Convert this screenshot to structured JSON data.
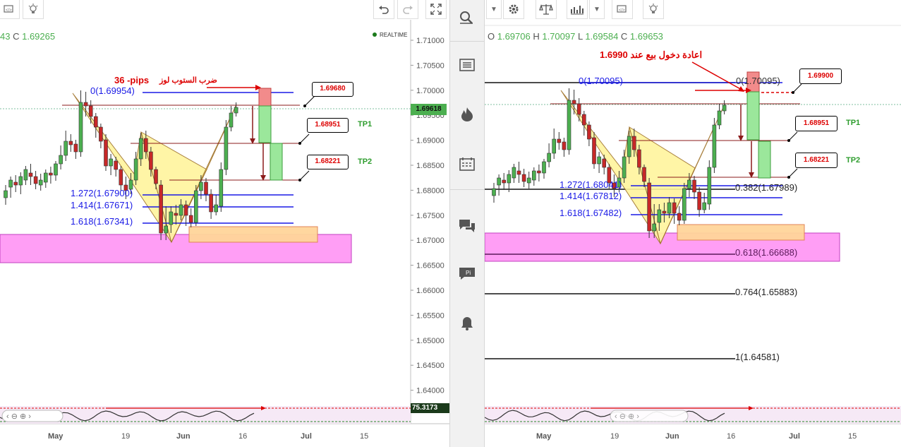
{
  "left_chart": {
    "ohlc_visible": {
      "prefix": "43",
      "close_label": "C",
      "close_value": "1.69265"
    },
    "realtime_label": "REALTIME",
    "price_axis": [
      "1.71000",
      "1.70500",
      "1.70000",
      "1.69500",
      "1.69000",
      "1.68500",
      "1.68000",
      "1.67500",
      "1.67000",
      "1.66500",
      "1.66000",
      "1.65500",
      "1.65000",
      "1.64500",
      "1.64000"
    ],
    "current_price": "1.69618",
    "indicator_value": "75.3173",
    "time_axis": [
      "May",
      "19",
      "Jun",
      "16",
      "Jul",
      "15"
    ],
    "annotations": {
      "pips": "36 -pips",
      "arabic_note": "ضرب الستوب لوز",
      "box1": "1.69680",
      "box2": "1.68951",
      "box3": "1.68221",
      "tp1": "TP1",
      "tp2": "TP2"
    },
    "fib_labels": {
      "f0": "0(1.69954)",
      "f1272": "1.272(1.67900)",
      "f1414": "1.414(1.67671)",
      "f1618": "1.618(1.67341)"
    }
  },
  "right_chart": {
    "ohlc": [
      {
        "k": "O",
        "v": "1.69706"
      },
      {
        "k": "H",
        "v": "1.70097"
      },
      {
        "k": "L",
        "v": "1.69584"
      },
      {
        "k": "C",
        "v": "1.69653"
      }
    ],
    "annotations": {
      "reentry_note": "اعادة دخول بيع عند 1.6990",
      "box1": "1.69900",
      "box2": "1.68951",
      "box3": "1.68221",
      "tp1": "TP1",
      "tp2": "TP2"
    },
    "fib_labels": {
      "f0": "0(1.70095)",
      "f0_right": "0(1.70095)",
      "f1272": "1.272(1.68041)",
      "f1414": "1.414(1.67812)",
      "f1618": "1.618(1.67482)",
      "f0382": "0.382(1.67989)",
      "f0618": "0.618(1.66688)",
      "f0764": "0.764(1.65883)",
      "f1": "1(1.64581)"
    },
    "time_axis": [
      "May",
      "19",
      "Jun",
      "16",
      "Jul",
      "15"
    ]
  },
  "sidebar_icons": [
    "search-icon",
    "list-icon",
    "fire-icon",
    "calendar-icon",
    "chat-icon",
    "ideas-icon",
    "bell-icon"
  ],
  "toolbar_icons": {
    "left": [
      "code-icon",
      "lightbulb-icon",
      "undo-icon",
      "redo-icon",
      "fullscreen-icon"
    ],
    "right": [
      "dropdown-icon",
      "gear-icon",
      "scales-icon",
      "bar-chart-icon",
      "dropdown-icon",
      "code-icon",
      "lightbulb-icon"
    ]
  },
  "colors": {
    "up": "#4caf50",
    "down": "#c62828",
    "harmonic_fill": "#fff59d",
    "zone_pink": "#ff9ef5",
    "zone_orange": "#ffd59a",
    "fib_blue": "#1a1ae6",
    "price_label_bg": "#4caf50"
  }
}
